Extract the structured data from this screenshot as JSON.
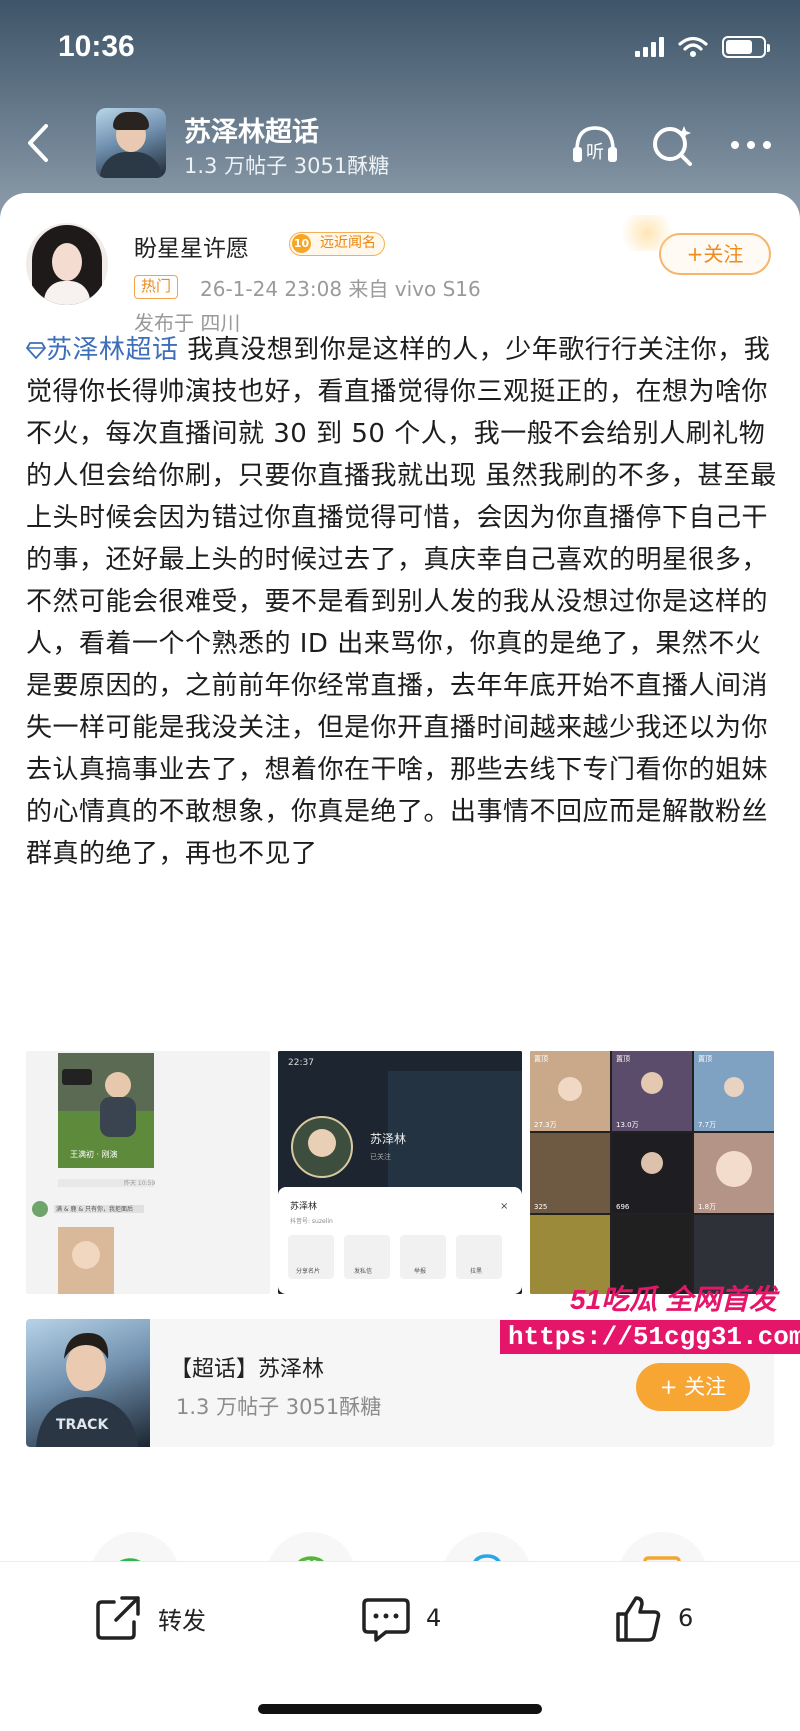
{
  "status_bar": {
    "time": "10:36"
  },
  "nav": {
    "title": "苏泽林超话",
    "stats": "1.3 万帖子 3051酥糖",
    "icons": [
      "back-icon",
      "listen-icon",
      "search-icon",
      "more-icon"
    ],
    "listen_label": "听"
  },
  "post": {
    "author": "盼星星许愿",
    "level_badge": "远近闻名",
    "level_number": "10",
    "hot_tag": "热门",
    "meta": "26-1-24 23:08  来自 vivo S16",
    "location": "发布于 四川",
    "follow_label": "+关注",
    "topic_link": "苏泽林超话",
    "body": " 我真没想到你是这样的人，少年歌行行关注你，我觉得你长得帅演技也好，看直播觉得你三观挺正的，在想为啥你不火，每次直播间就 30 到 50 个人，我一般不会给别人刷礼物的人但会给你刷，只要你直播我就出现 虽然我刷的不多，甚至最上头时候会因为错过你直播觉得可惜，会因为你直播停下自己干的事，还好最上头的时候过去了，真庆幸自己喜欢的明星很多，不然可能会很难受，要不是看到别人发的我从没想过你是这样的人，看着一个个熟悉的 ID 出来骂你，你真的是绝了，果然不火是要原因的，之前前年你经常直播，去年年底开始不直播人间消失一样可能是我没关注，但是你开直播时间越来越少我还以为你去认真搞事业去了，想着你在干啥，那些去线下专门看你的姐妹的心情真的不敢想象，你真是绝了。出事情不回应而是解散粉丝群真的绝了，再也不见了"
  },
  "images": {
    "img1": {
      "caption_a": "王满初 · 刚演",
      "caption_b": "昨天 10:59",
      "chat_name": "满 & 鹿 & 只有你，我拒面后"
    },
    "img2": {
      "time": "22:37",
      "name": "苏泽林",
      "sub": "已关注",
      "sheet_name": "苏泽林",
      "sheet_id": "抖音号: suzelin",
      "actions": [
        "分享名片",
        "发私信",
        "举报",
        "拉黑"
      ]
    },
    "img3": {
      "counts": [
        "27.3万",
        "13.0万",
        "7.7万",
        "325",
        "696",
        "1.8万"
      ],
      "tags": [
        "置顶",
        "置顶",
        "置顶"
      ]
    }
  },
  "topic_card": {
    "title": "【超话】苏泽林",
    "stats": "1.3 万帖子  3051酥糖",
    "follow_label": "+ 关注"
  },
  "watermark": {
    "title": "51吃瓜 全网首发",
    "url": "https://51cgg31.com"
  },
  "share": [
    "wechat-icon",
    "moments-icon",
    "qq-icon",
    "save-image-icon"
  ],
  "bottom_bar": {
    "repost_label": "转发",
    "comment_count": "4",
    "like_count": "6"
  },
  "colors": {
    "accent": "#f7a533",
    "link": "#3e6fb8",
    "watermark": "#e5166a"
  }
}
